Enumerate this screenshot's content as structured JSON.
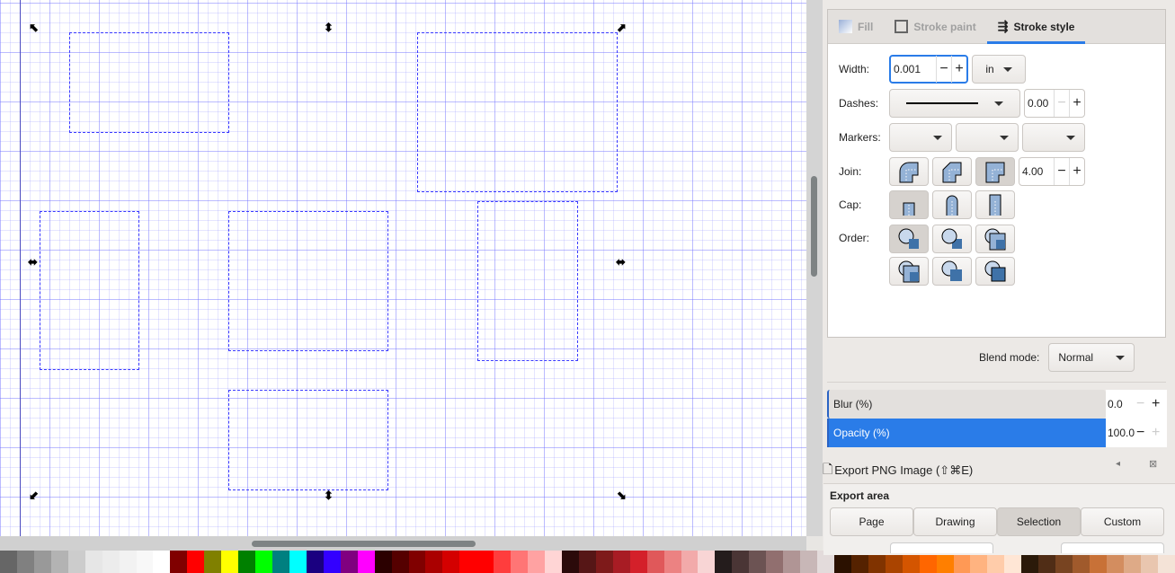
{
  "canvas": {
    "handles": [
      "resize-nw",
      "resize-n",
      "resize-ne",
      "resize-w",
      "resize-e",
      "resize-sw",
      "resize-s",
      "resize-se"
    ]
  },
  "fill_stroke": {
    "tabs": [
      {
        "label": "Fill",
        "active": false
      },
      {
        "label": "Stroke paint",
        "active": false
      },
      {
        "label": "Stroke style",
        "active": true
      }
    ],
    "width": {
      "label": "Width:",
      "value": "0.001",
      "unit": "in"
    },
    "dashes": {
      "label": "Dashes:",
      "offset": "0.00"
    },
    "markers": {
      "label": "Markers:"
    },
    "join": {
      "label": "Join:",
      "options": [
        "round",
        "bevel",
        "miter"
      ],
      "selected": "miter",
      "miter_limit": "4.00"
    },
    "cap": {
      "label": "Cap:",
      "options": [
        "butt",
        "round",
        "square"
      ],
      "selected": "butt"
    },
    "order": {
      "label": "Order:",
      "selected": 0
    },
    "blend": {
      "label": "Blend mode:",
      "value": "Normal"
    },
    "blur": {
      "label": "Blur (%)",
      "value": "0.0"
    },
    "opacity": {
      "label": "Opacity (%)",
      "value": "100.0"
    }
  },
  "export": {
    "title": "Export PNG Image (⇧⌘E)",
    "area_label": "Export area",
    "buttons": [
      "Page",
      "Drawing",
      "Selection",
      "Custom"
    ],
    "selected": "Selection"
  },
  "palette": [
    "#666666",
    "#808080",
    "#999999",
    "#b3b3b3",
    "#cccccc",
    "#e6e6e6",
    "#ececec",
    "#f2f2f2",
    "#f8f8f8",
    "#ffffff",
    "#800000",
    "#ff0000",
    "#808000",
    "#ffff00",
    "#008000",
    "#00ff00",
    "#008080",
    "#00ffff",
    "#1a0080",
    "#3300ff",
    "#800080",
    "#ff00ff",
    "#2b0000",
    "#550000",
    "#800000",
    "#aa0000",
    "#d40000",
    "#ff0000",
    "#ff0000",
    "#ff3d3d",
    "#ff7575",
    "#ffa2a2",
    "#ffd5d5",
    "#2b0a0a",
    "#561616",
    "#7e1a1a",
    "#a81c24",
    "#d4202a",
    "#e0585a",
    "#ec8282",
    "#f2aaaa",
    "#f8d5d5",
    "#241c1c",
    "#4a3535",
    "#6c5353",
    "#916f6f",
    "#b09595",
    "#c8b7b7",
    "#e3dbdb",
    "#2b1100",
    "#552200",
    "#803300",
    "#aa4400",
    "#d45500",
    "#ff6600",
    "#ff7f00",
    "#ff9955",
    "#ffb380",
    "#ffccaa",
    "#ffe6d5",
    "#2b1a0a",
    "#502d16",
    "#784421",
    "#a05a2c",
    "#c87137",
    "#d38d5f",
    "#deaa87",
    "#e9c6af",
    "#f4e3d7"
  ]
}
